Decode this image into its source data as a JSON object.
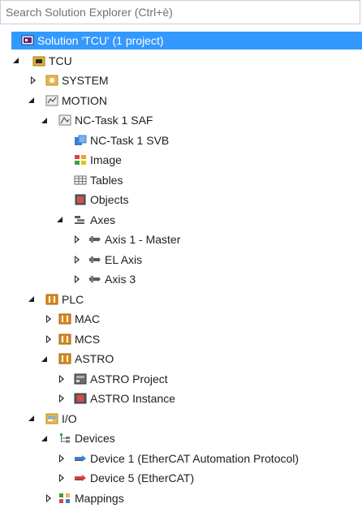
{
  "search": {
    "placeholder": "Search Solution Explorer (Ctrl+è)"
  },
  "tree": {
    "solution": {
      "label": "Solution 'TCU' (1 project)"
    },
    "tcu": {
      "label": "TCU"
    },
    "system": {
      "label": "SYSTEM"
    },
    "motion": {
      "label": "MOTION"
    },
    "nc_task": {
      "label": "NC-Task 1 SAF"
    },
    "nc_task_svb": {
      "label": "NC-Task 1 SVB"
    },
    "image": {
      "label": "Image"
    },
    "tables": {
      "label": "Tables"
    },
    "objects": {
      "label": "Objects"
    },
    "axes": {
      "label": "Axes"
    },
    "axis1": {
      "label": "Axis 1 - Master"
    },
    "el_axis": {
      "label": "EL Axis"
    },
    "axis3": {
      "label": "Axis 3"
    },
    "plc": {
      "label": "PLC"
    },
    "mac": {
      "label": "MAC"
    },
    "mcs": {
      "label": "MCS"
    },
    "astro": {
      "label": "ASTRO"
    },
    "astro_project": {
      "label": "ASTRO Project"
    },
    "astro_instance": {
      "label": "ASTRO Instance"
    },
    "io": {
      "label": "I/O"
    },
    "devices": {
      "label": "Devices"
    },
    "device1": {
      "label": "Device 1 (EtherCAT Automation Protocol)"
    },
    "device5": {
      "label": "Device 5 (EtherCAT)"
    },
    "mappings": {
      "label": "Mappings"
    }
  },
  "colors": {
    "selection": "#3399ff",
    "folder_yellow": "#e8b84a",
    "plc_orange": "#d98a1c",
    "tcu_gold": "#e0b03a"
  }
}
